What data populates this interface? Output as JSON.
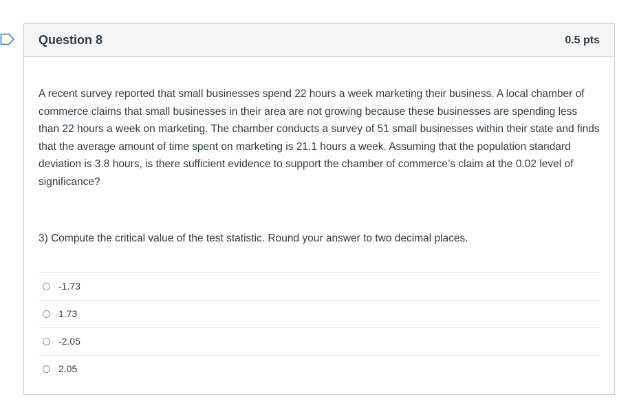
{
  "question": {
    "title": "Question 8",
    "points": "0.5 pts",
    "text": "A recent survey reported that small businesses spend 22 hours a week marketing their business. A local chamber of commerce claims that small businesses in their area are not growing because these businesses are spending less than 22 hours a week on marketing. The chamber conducts a survey of 51 small businesses within their state and finds that the average amount of time spent on marketing is 21.1 hours a week. Assuming that the population standard deviation is 3.8 hours, is there sufficient evidence to support the chamber of commerce’s claim at the 0.02 level of significance?",
    "subquestion": "3) Compute the critical value of the test statistic. Round your answer to two decimal places.",
    "answers": [
      {
        "label": "-1.73"
      },
      {
        "label": "1.73"
      },
      {
        "label": "-2.05"
      },
      {
        "label": "2.05"
      }
    ]
  },
  "colors": {
    "flag_stroke": "#2d7bd3",
    "text": "#2d3b45",
    "header_bg": "#f5f5f5",
    "border": "#c7cdd1"
  },
  "icons": {
    "flag": "bookmark-flag-icon",
    "radio": "radio-unchecked-icon"
  }
}
